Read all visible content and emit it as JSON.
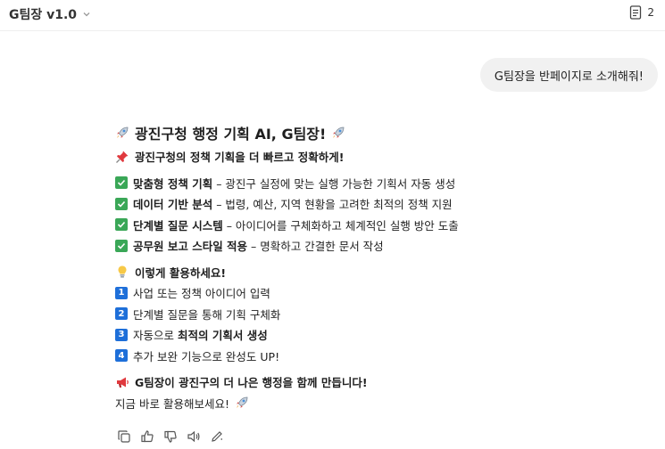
{
  "header": {
    "title": "G팀장 v1.0",
    "doc_count": "2"
  },
  "user_message": "G팀장을 반페이지로 소개해줘!",
  "response": {
    "heading": "광진구청 행정 기획 AI, G팀장!",
    "tagline": "광진구청의 정책 기획을 더 빠르고 정확하게!",
    "features": [
      {
        "bold": "맞춤형 정책 기획",
        "rest": " – 광진구 실정에 맞는 실행 가능한 기획서 자동 생성"
      },
      {
        "bold": "데이터 기반 분석",
        "rest": " – 법령, 예산, 지역 현황을 고려한 최적의 정책 지원"
      },
      {
        "bold": "단계별 질문 시스템",
        "rest": " – 아이디어를 구체화하고 체계적인 실행 방안 도출"
      },
      {
        "bold": "공무원 보고 스타일 적용",
        "rest": " – 명확하고 간결한 문서 작성"
      }
    ],
    "usage_heading": "이렇게 활용하세요!",
    "steps": [
      {
        "num": "1",
        "text": "사업 또는 정책 아이디어 입력"
      },
      {
        "num": "2",
        "text": "단계별 질문을 통해 기획 구체화"
      },
      {
        "num": "3",
        "text": "자동으로 ",
        "bold": "최적의 기획서 생성"
      },
      {
        "num": "4",
        "text": "추가 보완 기능으로 완성도 UP!"
      }
    ],
    "closing_bold": "G팀장이 광진구의 더 나은 행정을 함께 만듭니다!",
    "closing": "지금 바로 활용해보세요!"
  },
  "icons": {
    "rocket": "rocket-icon",
    "pin": "pushpin-icon",
    "check": "check-mark-icon",
    "bulb": "light-bulb-icon",
    "megaphone": "megaphone-icon"
  },
  "colors": {
    "check": "#3aa757",
    "number": "#1e6fd9",
    "bubble": "#f1f1f1"
  }
}
